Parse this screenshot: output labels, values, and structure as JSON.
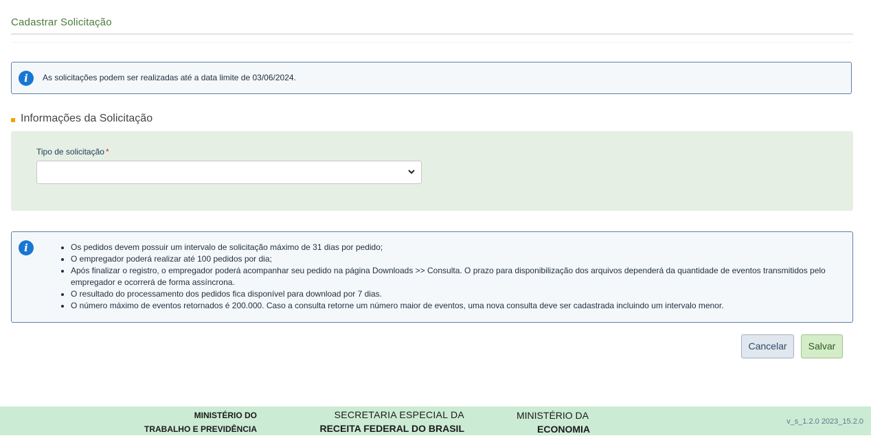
{
  "header": {
    "title": "Cadastrar Solicitação"
  },
  "top_notice": {
    "icon": "info-icon",
    "text": "As solicitações podem ser realizadas até a data limite de 03/06/2024."
  },
  "section": {
    "title": "Informações da Solicitação",
    "marker_color": "#f0a500"
  },
  "form": {
    "type_label": "Tipo de solicitação",
    "required_mark": "*",
    "type_value": ""
  },
  "notes": {
    "icon": "info-icon",
    "items": [
      "Os pedidos devem possuir um intervalo de solicitação máximo de 31 dias por pedido;",
      "O empregador poderá realizar até 100 pedidos por dia;",
      "Após finalizar o registro, o empregador poderá acompanhar seu pedido na página Downloads >> Consulta. O prazo para disponibilização dos arquivos dependerá da quantidade de eventos transmitidos pelo empregador e ocorrerá de forma assíncrona.",
      "O resultado do processamento dos pedidos fica disponível para download por 7 dias.",
      "O número máximo de eventos retornados é 200.000. Caso a consulta retorne um número maior de eventos, uma nova consulta deve ser cadastrada incluindo um intervalo menor."
    ]
  },
  "actions": {
    "cancel_label": "Cancelar",
    "save_label": "Salvar"
  },
  "footer": {
    "org1_line1": "MINISTÉRIO DO",
    "org1_line2": "TRABALHO E PREVIDÊNCIA",
    "org2_line1": "SECRETARIA ESPECIAL DA",
    "org2_line2": "RECEITA FEDERAL DO BRASIL",
    "org3_line1": "MINISTÉRIO DA",
    "org3_line2": "ECONOMIA",
    "version": "v_s_1.2.0 2023_15.2.0",
    "background": "#ccebd4"
  },
  "colors": {
    "accent_green": "#4c7a3c",
    "info_blue": "#1976d2",
    "required_red": "#c62828"
  }
}
